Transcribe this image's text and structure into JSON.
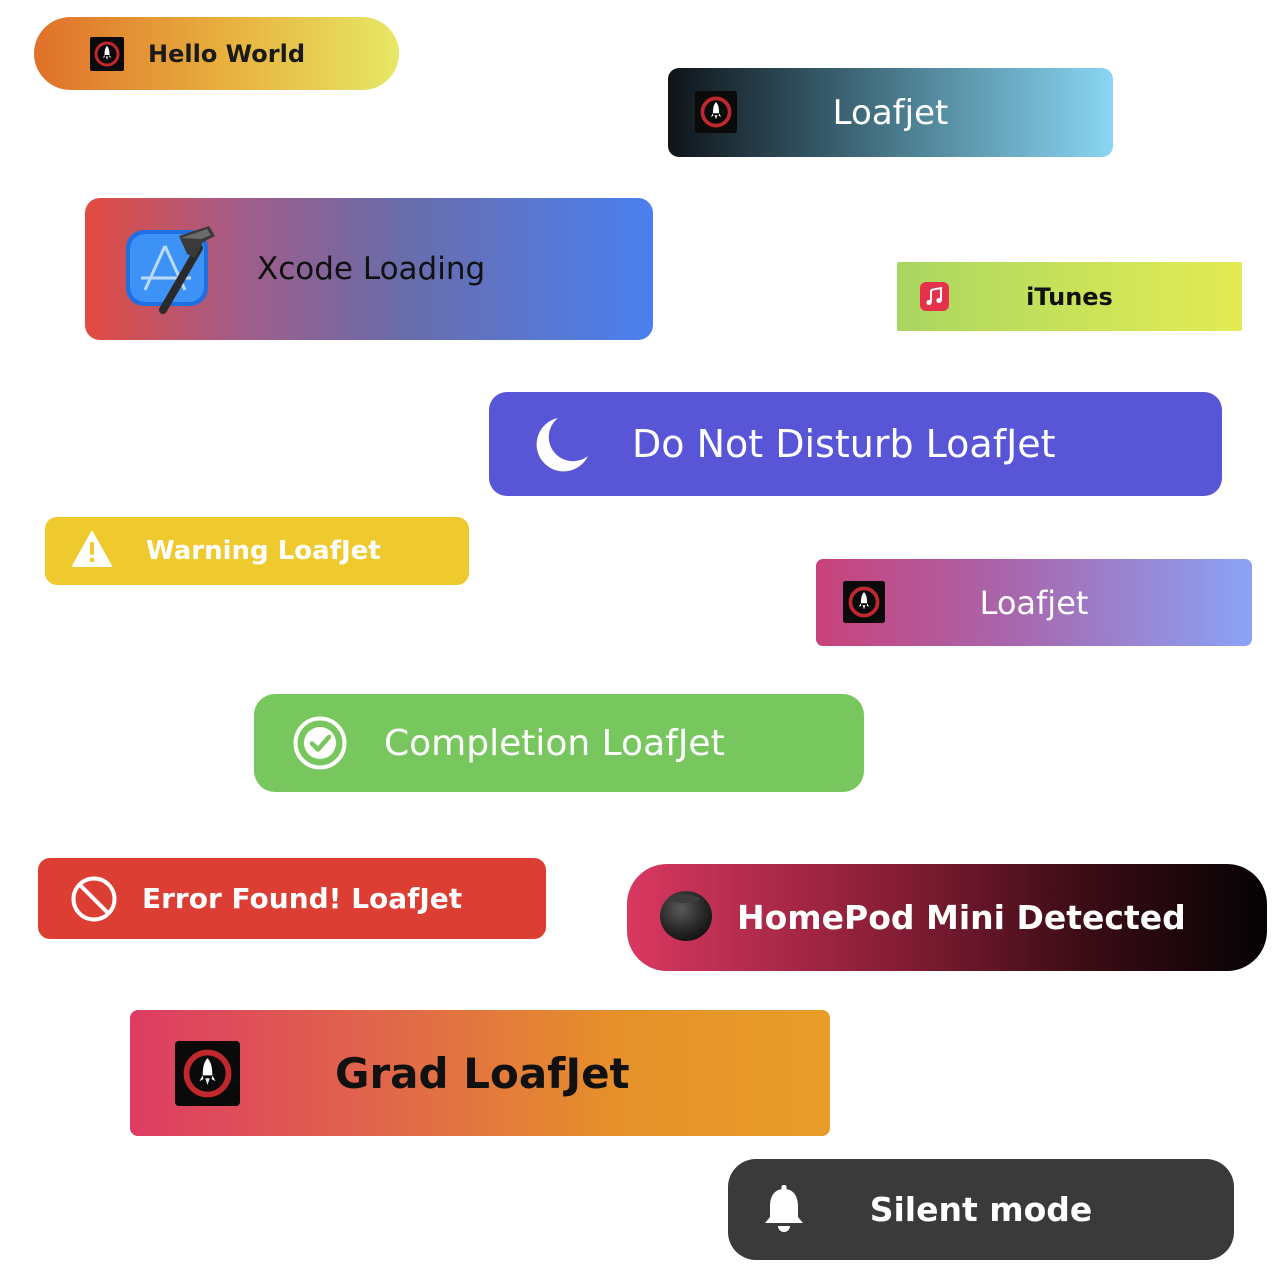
{
  "toasts": [
    {
      "label": "Hello World",
      "icon": "rocket-app-icon",
      "background": [
        "#e0702a",
        "#e6e866"
      ]
    },
    {
      "label": "Loafjet",
      "icon": "rocket-app-icon",
      "background": [
        "#0f1418",
        "#8ad6f4"
      ]
    },
    {
      "label": "Xcode Loading",
      "icon": "xcode-icon",
      "background": [
        "#e34b41",
        "#4a80f0"
      ]
    },
    {
      "label": "iTunes",
      "icon": "music-icon",
      "background": [
        "#a9d660",
        "#e3eb53"
      ]
    },
    {
      "label": "Do Not Disturb LoafJet",
      "icon": "moon-icon",
      "background": [
        "#5856d6"
      ]
    },
    {
      "label": "Warning LoafJet",
      "icon": "warning-icon",
      "background": [
        "#efca2f"
      ]
    },
    {
      "label": "Loafjet",
      "icon": "rocket-app-icon",
      "background": [
        "#c9427a",
        "#8aa3f6"
      ]
    },
    {
      "label": "Completion LoafJet",
      "icon": "checkmark-circle-icon",
      "background": [
        "#78c75e"
      ]
    },
    {
      "label": "Error Found! LoafJet",
      "icon": "prohibited-icon",
      "background": [
        "#dc3e33"
      ]
    },
    {
      "label": "HomePod Mini Detected",
      "icon": "homepod-mini-icon",
      "background": [
        "#d93860",
        "#050203"
      ]
    },
    {
      "label": "Grad LoafJet",
      "icon": "rocket-app-icon",
      "background": [
        "#de3c63",
        "#e89d27"
      ]
    },
    {
      "label": "Silent mode",
      "icon": "bell-icon",
      "background": [
        "#3a3a3a"
      ]
    }
  ]
}
